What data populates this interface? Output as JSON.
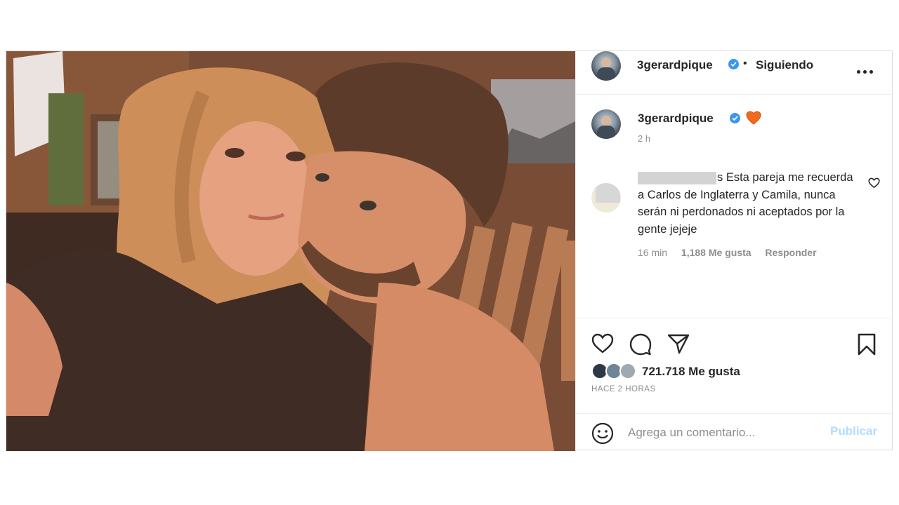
{
  "post": {
    "author": {
      "username": "3gerardpique",
      "verified": true,
      "follow_status": "Siguiendo",
      "separator": "•",
      "avatar_icon": "profile-avatar"
    },
    "caption": {
      "username": "3gerardpique",
      "emoji": "orange-heart-icon",
      "time": "2 h"
    },
    "comments": [
      {
        "username_redacted": true,
        "text_tail": "s Esta pareja me recuerda a Carlos de Inglaterra y Camila, nunca serán ni perdonados ni aceptados por la gente jejeje",
        "time": "16 min",
        "likes": "1,188 Me gusta",
        "reply_label": "Responder"
      }
    ],
    "actions": {
      "like_icon": "heart-icon",
      "comment_icon": "comment-icon",
      "share_icon": "send-icon",
      "save_icon": "bookmark-icon"
    },
    "likes_text": "721.718 Me gusta",
    "posted_ago": "HACE 2 HORAS",
    "add_comment": {
      "placeholder": "Agrega un comentario...",
      "publish_label": "Publicar"
    }
  },
  "colors": {
    "verified": "#3897f0",
    "publish_disabled": "#b3dbff",
    "heart_orange": "#f26b1d",
    "muted_text": "#8e8e8e"
  }
}
